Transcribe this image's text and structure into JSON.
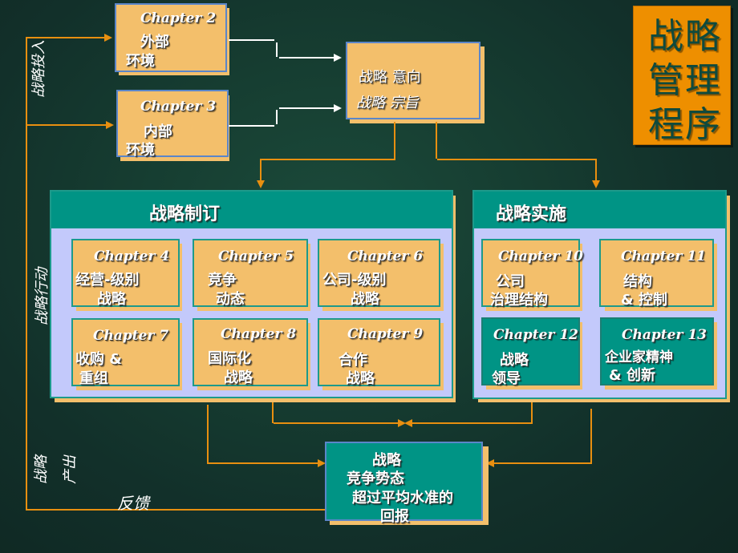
{
  "title": {
    "line1": "战略",
    "line2": "管理",
    "line3": "程序"
  },
  "side_labels": {
    "inputs": "战略投入",
    "actions": "战略行动",
    "outcomes_1": "战略",
    "outcomes_2": "产出",
    "feedback": "反馈"
  },
  "inputs": [
    {
      "chapter": "Chapter 2",
      "line1": "外部",
      "line2": "环境"
    },
    {
      "chapter": "Chapter 3",
      "line1": "内部",
      "line2": "环境"
    }
  ],
  "intent": {
    "line1": "战略 意向",
    "line2": "战略 宗旨"
  },
  "formulation": {
    "title": "战略制订",
    "chapters": [
      {
        "chapter": "Chapter 4",
        "line1": "经营-级别",
        "line2": "战略"
      },
      {
        "chapter": "Chapter 5",
        "line1": "竞争",
        "line2": "动态"
      },
      {
        "chapter": "Chapter 6",
        "line1": "公司-级别",
        "line2": "战略"
      },
      {
        "chapter": "Chapter 7",
        "line1": "收购 &",
        "line2": "重组"
      },
      {
        "chapter": "Chapter 8",
        "line1": "国际化",
        "line2": "战略"
      },
      {
        "chapter": "Chapter 9",
        "line1": "合作",
        "line2": "战略"
      }
    ]
  },
  "implementation": {
    "title": "战略实施",
    "chapters": [
      {
        "chapter": "Chapter 10",
        "line1": "公司",
        "line2": "治理结构"
      },
      {
        "chapter": "Chapter 11",
        "line1": "结构",
        "line2": "& 控制"
      },
      {
        "chapter": "Chapter 12",
        "line1": "战略",
        "line2": "领导"
      },
      {
        "chapter": "Chapter 13",
        "line1": "企业家精神",
        "line2": "& 创新"
      }
    ]
  },
  "outcome": {
    "line1": "战略",
    "line2": "竞争势态",
    "line3": "超过平均水准的",
    "line4": "回报"
  },
  "colors": {
    "background": "#163d31",
    "box_fill": "#f3bf6b",
    "teal": "#009485",
    "panel_fill": "#c3c9fb",
    "arrow_orange": "#e88f10",
    "title_box": "#ee8f00",
    "title_text": "#0f4a3d"
  }
}
